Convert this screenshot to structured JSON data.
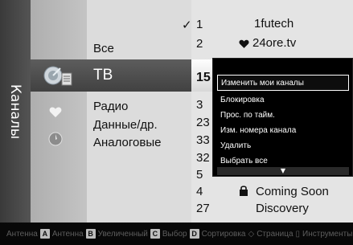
{
  "menu": {
    "title": "Каналы"
  },
  "categories": [
    {
      "label": "Все",
      "active": false
    },
    {
      "label": "ТВ",
      "active": true
    },
    {
      "label": "Радио",
      "active": false
    },
    {
      "label": "Данные/др.",
      "active": false
    },
    {
      "label": "Аналоговые",
      "active": false
    }
  ],
  "channels": [
    {
      "number": "1",
      "name": "1futech",
      "checked": true,
      "favorite": false
    },
    {
      "number": "2",
      "name": "24ore.tv",
      "checked": false,
      "favorite": true
    },
    {
      "number": "15",
      "name": "",
      "active": true
    },
    {
      "number": "3",
      "name": ""
    },
    {
      "number": "23",
      "name": ""
    },
    {
      "number": "33",
      "name": ""
    },
    {
      "number": "32",
      "name": ""
    },
    {
      "number": "5",
      "name": ""
    },
    {
      "number": "4",
      "name": "Coming Soon",
      "locked": true
    },
    {
      "number": "27",
      "name": "Discovery"
    }
  ],
  "tools_popup": {
    "items": [
      {
        "label": "Изменить мои каналы",
        "selected": true
      },
      {
        "label": "Блокировка",
        "selected": false
      },
      {
        "label": "Прос. по тайм.",
        "selected": false
      },
      {
        "label": "Изм. номера канала",
        "selected": false
      },
      {
        "label": "Удалить",
        "selected": false
      },
      {
        "label": "Выбрать все",
        "selected": false
      }
    ],
    "more_indicator": "▼"
  },
  "bottom_bar": {
    "items": [
      {
        "key": "",
        "label": "Антенна"
      },
      {
        "key": "A",
        "label": "Антенна"
      },
      {
        "key": "B",
        "label": "Увеличенный"
      },
      {
        "key": "C",
        "label": "Выбор"
      },
      {
        "key": "D",
        "label": "Сортировка"
      },
      {
        "key": "◇",
        "label": "Страница"
      },
      {
        "key": "▯",
        "label": "Инструменты"
      }
    ]
  },
  "colors": {
    "background": "#0c0c0c",
    "panel": "#cfcfcf",
    "highlight_dark": "#4a4a4a",
    "popup": "#000000",
    "bottom_text": "#5e5e5e"
  },
  "icons": {
    "antenna": "satellite-dish-icon",
    "favorite": "heart-icon",
    "tools": "tools-icon",
    "lock": "lock-icon"
  }
}
